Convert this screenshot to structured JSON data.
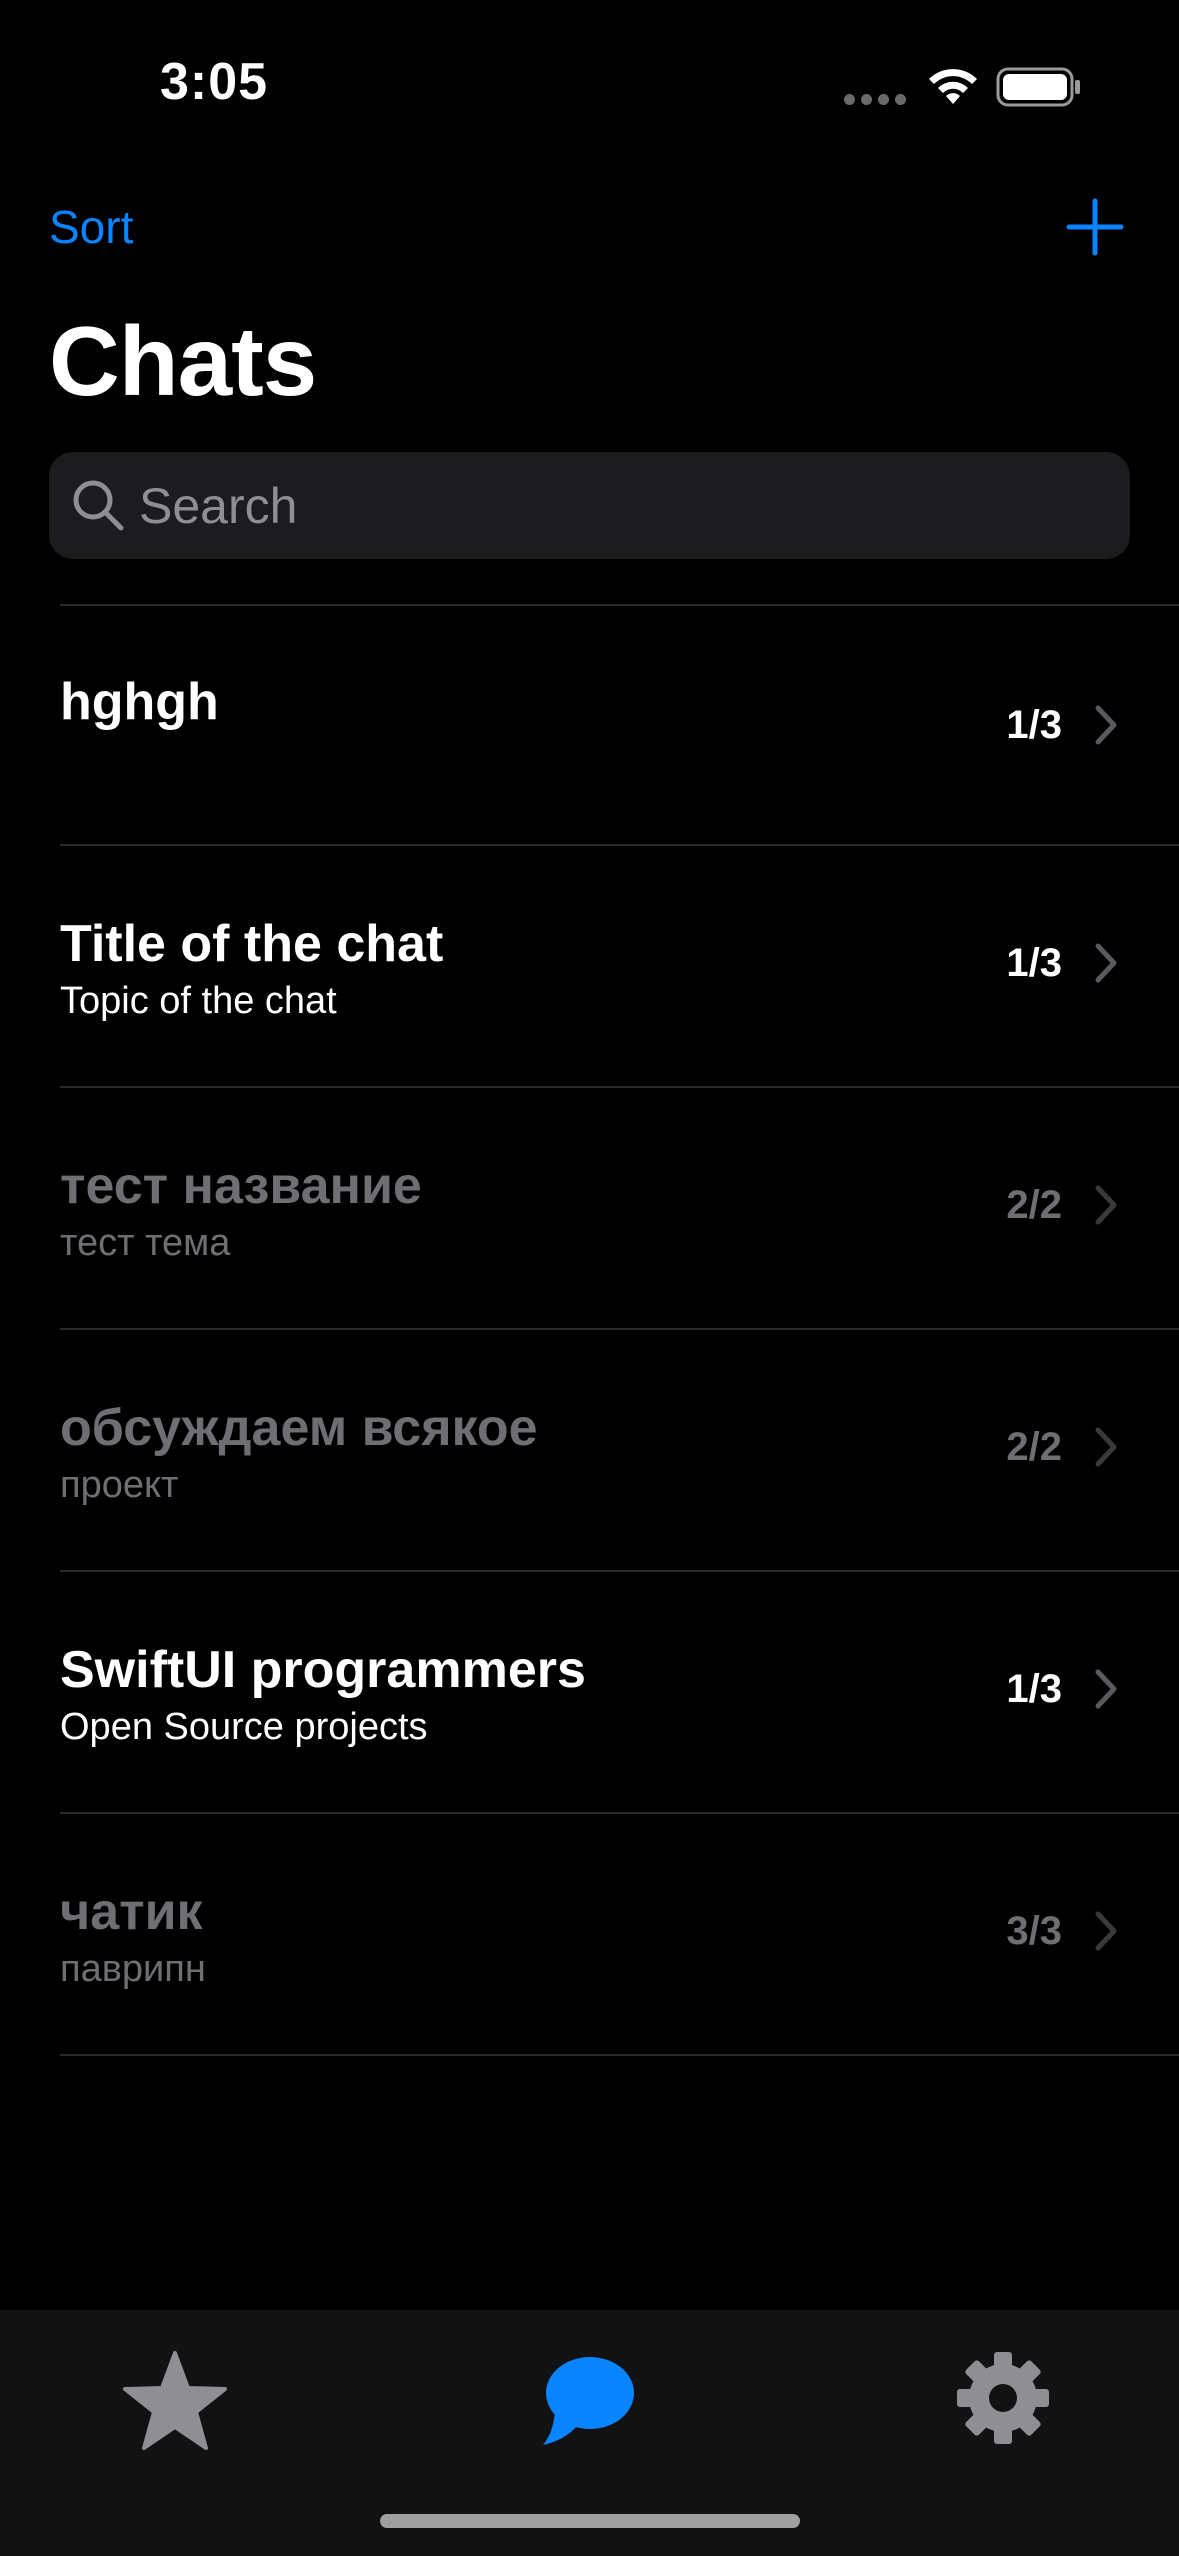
{
  "status": {
    "time": "3:05"
  },
  "nav": {
    "sort_label": "Sort",
    "add_icon": "plus-icon"
  },
  "page": {
    "title": "Chats"
  },
  "search": {
    "placeholder": "Search"
  },
  "chats": [
    {
      "title": "hghgh",
      "topic": "",
      "count": "1/3",
      "muted": false
    },
    {
      "title": "Title of the chat",
      "topic": "Topic of the chat",
      "count": "1/3",
      "muted": false
    },
    {
      "title": "тест название",
      "topic": "тест тема",
      "count": "2/2",
      "muted": true
    },
    {
      "title": "обсуждаем всякое",
      "topic": "проект",
      "count": "2/2",
      "muted": true
    },
    {
      "title": "SwiftUI programmers",
      "topic": "Open Source projects",
      "count": "1/3",
      "muted": false
    },
    {
      "title": "чатик",
      "topic": "паврипн",
      "count": "3/3",
      "muted": true
    }
  ],
  "tabs": [
    {
      "icon": "star-icon",
      "active": false
    },
    {
      "icon": "chat-bubble-icon",
      "active": true
    },
    {
      "icon": "gear-icon",
      "active": false
    }
  ],
  "colors": {
    "accent": "#0a84ff",
    "inactive_tab": "#8e8e93",
    "muted_text": "#6e6e73"
  }
}
